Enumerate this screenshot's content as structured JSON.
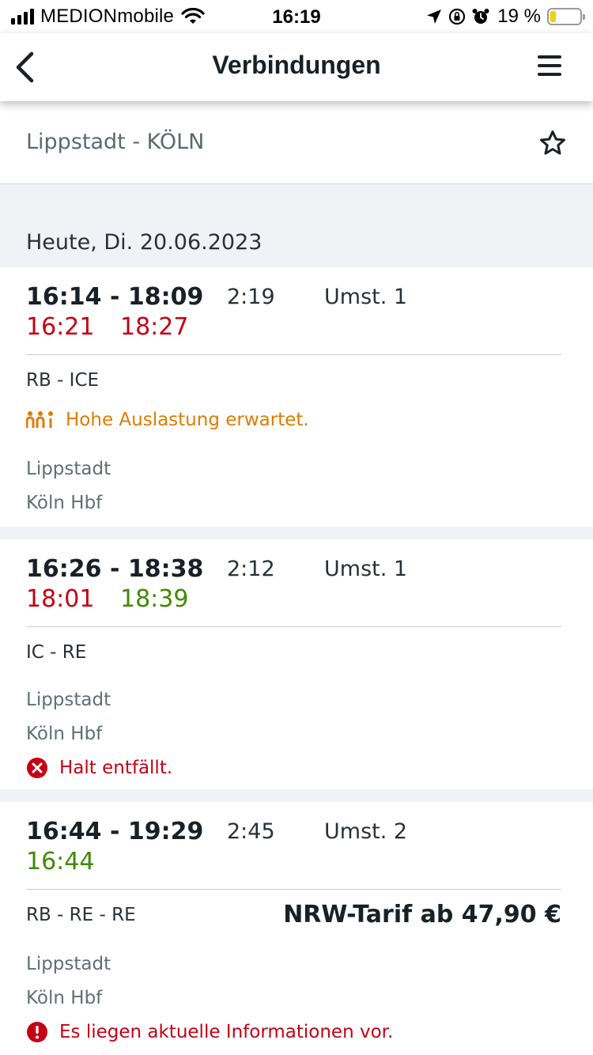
{
  "status_bar": {
    "carrier": "MEDIONmobile",
    "time": "16:19",
    "battery_percent": "19 %",
    "battery_level": 0.19
  },
  "nav": {
    "title": "Verbindungen"
  },
  "route": {
    "title": "Lippstadt - KÖLN"
  },
  "date_header": "Heute, Di. 20.06.2023",
  "connections": [
    {
      "times": "16:14 - 18:09",
      "duration": "2:19",
      "transfers": "Umst. 1",
      "rt_departure": "16:21",
      "rt_arrival": "18:27",
      "products": "RB - ICE",
      "notice": "Hohe Auslastung erwartet.",
      "from": "Lippstadt",
      "to": "Köln Hbf"
    },
    {
      "times": "16:26 - 18:38",
      "duration": "2:12",
      "transfers": "Umst. 1",
      "rt_departure": "18:01",
      "rt_arrival": "18:39",
      "products": "IC - RE",
      "from": "Lippstadt",
      "to": "Köln Hbf",
      "notice": "Halt entfällt."
    },
    {
      "times": "16:44 - 19:29",
      "duration": "2:45",
      "transfers": "Umst. 2",
      "rt_departure": "16:44",
      "products": "RB - RE - RE",
      "price": "NRW-Tarif ab 47,90 €",
      "from": "Lippstadt",
      "to": "Köln Hbf",
      "notice": "Es liegen aktuelle Informationen vor."
    }
  ],
  "colors": {
    "delay_red": "#c50014",
    "ontime_green": "#408a00",
    "warning_orange": "#e07b00",
    "background_grey": "#f0f2f5"
  },
  "icons": [
    "back-arrow-icon",
    "menu-icon",
    "star-icon",
    "occupancy-icon",
    "cancel-icon",
    "alert-icon"
  ]
}
